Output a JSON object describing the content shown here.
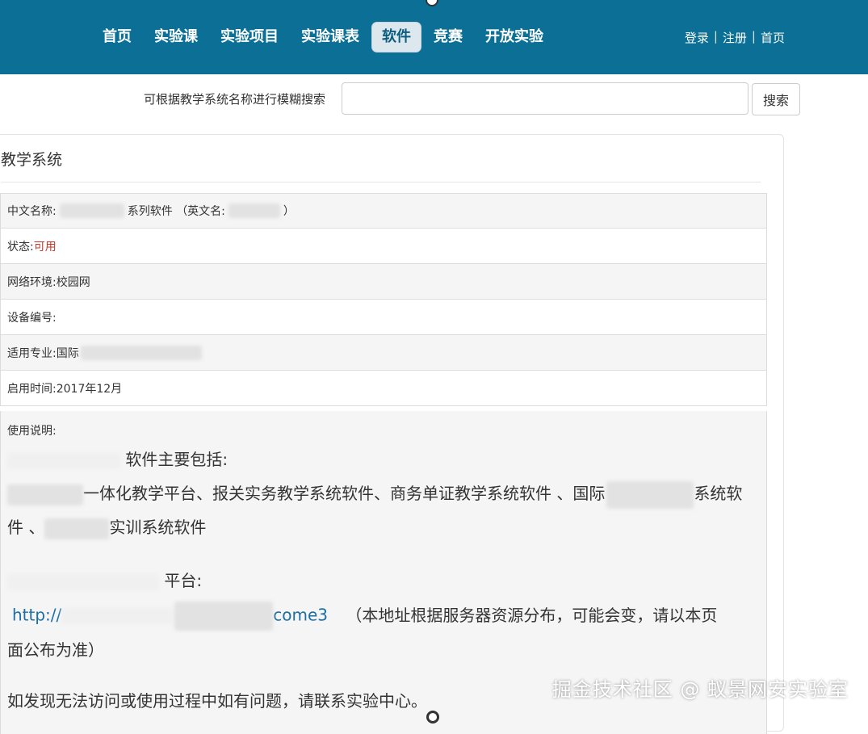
{
  "nav": {
    "items": [
      {
        "label": "首页"
      },
      {
        "label": "实验课"
      },
      {
        "label": "实验项目"
      },
      {
        "label": "实验课表"
      },
      {
        "label": "软件",
        "active": true
      },
      {
        "label": "竞赛"
      },
      {
        "label": "开放实验"
      }
    ],
    "user_links": {
      "login": "登录",
      "register": "注册",
      "home": "首页",
      "separator": "|"
    }
  },
  "search": {
    "label": "可根据教学系统名称进行模糊搜索",
    "placeholder": "",
    "value": "",
    "button": "搜索"
  },
  "panel": {
    "title": "教学系统",
    "rows": {
      "name_label": "中文名称:",
      "name_suffix": "系列软件 （英文名:",
      "name_close": "）",
      "status_label": "状态:",
      "status_value": "可用",
      "network_label": "网络环境:",
      "network_value": "校园网",
      "device_label": "设备编号:",
      "major_label": "适用专业:",
      "major_value": "国际",
      "date_label": "启用时间:",
      "date_value": "2017年12月"
    },
    "description": {
      "label": "使用说明:",
      "line1": "软件主要包括:",
      "line2a": "一体化教学平台、报关实务教学系统软件、商务单证教学系统软件 、国际",
      "line2b": "系统软",
      "line3a": "件 、",
      "line3b": "实训系统软件",
      "line4": "平台:",
      "link_a": "http://",
      "link_b": "come3",
      "line5a": "（本地址根据服务器资源分布，可能会变，请以本页",
      "line5b": "面公布为准）",
      "line6": "如发现无法访问或使用过程中如有问题，请联系实验中心。"
    }
  },
  "watermark": "掘金技术社区 @ 蚁景网安实验室",
  "colors": {
    "nav_bg": "#0b6f96",
    "status": "#c0392b",
    "link": "#1c6ea4"
  }
}
